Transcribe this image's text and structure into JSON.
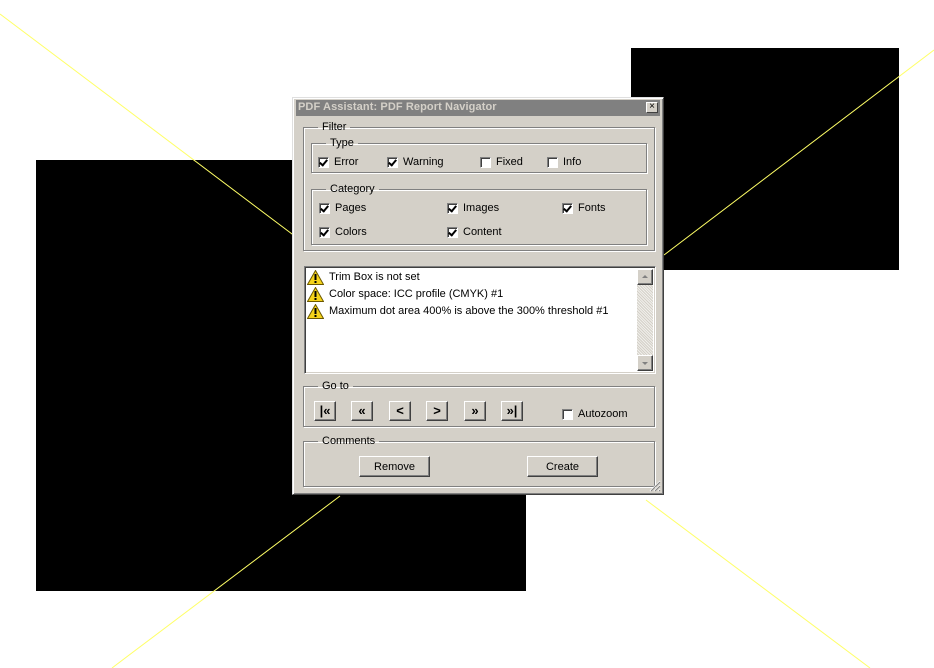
{
  "dialog": {
    "title": "PDF Assistant: PDF Report Navigator",
    "close_glyph": "×"
  },
  "filter": {
    "legend": "Filter",
    "type": {
      "legend": "Type",
      "items": [
        {
          "label": "Error",
          "checked": true
        },
        {
          "label": "Warning",
          "checked": true
        },
        {
          "label": "Fixed",
          "checked": false
        },
        {
          "label": "Info",
          "checked": false
        }
      ]
    },
    "category": {
      "legend": "Category",
      "items": [
        {
          "label": "Pages",
          "checked": true
        },
        {
          "label": "Images",
          "checked": true
        },
        {
          "label": "Fonts",
          "checked": true
        },
        {
          "label": "Colors",
          "checked": true
        },
        {
          "label": "Content",
          "checked": true
        }
      ]
    }
  },
  "report": {
    "items": [
      {
        "icon": "warning-icon",
        "text": "Trim Box is not set"
      },
      {
        "icon": "warning-icon",
        "text": "Color space: ICC profile (CMYK) #1"
      },
      {
        "icon": "warning-icon",
        "text": "Maximum dot area 400% is above the 300% threshold #1"
      }
    ]
  },
  "goto": {
    "legend": "Go to",
    "buttons": [
      {
        "name": "first-button",
        "glyph": "|«"
      },
      {
        "name": "previous-page-button",
        "glyph": "«"
      },
      {
        "name": "previous-button",
        "glyph": "<"
      },
      {
        "name": "next-button",
        "glyph": ">"
      },
      {
        "name": "next-page-button",
        "glyph": "»"
      },
      {
        "name": "last-button",
        "glyph": "»|"
      }
    ],
    "autozoom": {
      "label": "Autozoom",
      "checked": false
    }
  },
  "comments": {
    "legend": "Comments",
    "remove_label": "Remove",
    "create_label": "Create"
  },
  "colors": {
    "dialog_bg": "#d4d0c8",
    "titlebar_inactive": "#808080",
    "warning_yellow": "#f5d31b",
    "guide_line": "#ffff66"
  }
}
